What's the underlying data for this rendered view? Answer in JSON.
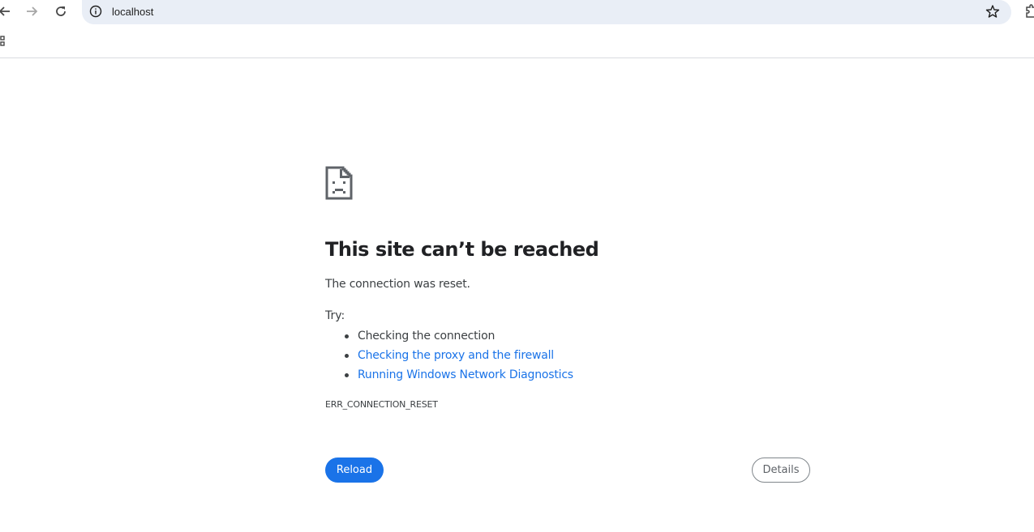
{
  "browser": {
    "address": "localhost",
    "icons": {
      "back": "arrow-left-icon",
      "forward": "arrow-right-icon",
      "reload": "reload-icon",
      "site_info": "info-icon",
      "bookmark": "star-icon",
      "extensions": "puzzle-icon",
      "apps": "apps-grid-icon"
    }
  },
  "error": {
    "icon": "sad-document-icon",
    "title": "This site can’t be reached",
    "description": "The connection was reset.",
    "try_label": "Try:",
    "suggestions": [
      {
        "text": "Checking the connection",
        "is_link": false
      },
      {
        "text": "Checking the proxy and the firewall",
        "is_link": true
      },
      {
        "text": "Running Windows Network Diagnostics",
        "is_link": true
      }
    ],
    "code": "ERR_CONNECTION_RESET",
    "reload_label": "Reload",
    "details_label": "Details"
  },
  "colors": {
    "accent": "#1a73e8",
    "text": "#202124",
    "secondary_text": "#3c4043",
    "omnibox_bg": "#e9eef6"
  }
}
